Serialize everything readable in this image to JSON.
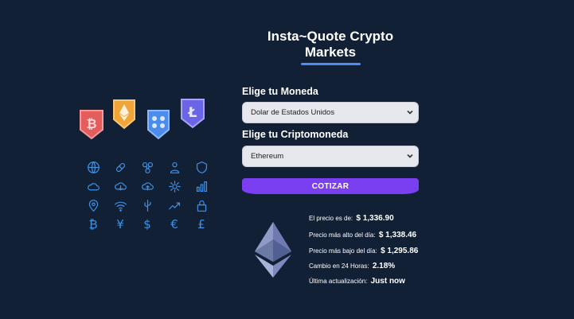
{
  "header": {
    "title": "Insta~Quote Crypto Markets"
  },
  "form": {
    "currency_label": "Elige tu Moneda",
    "currency_value": "Dolar de Estados Unidos",
    "crypto_label": "Elige tu Criptomoneda",
    "crypto_value": "Ethereum",
    "submit_label": "COTIZAR"
  },
  "result": {
    "price_label": "El precio es de:",
    "price_value": "$ 1,336.90",
    "high_label": "Precio más alto del día:",
    "high_value": "$ 1,338.46",
    "low_label": "Precio más bajo del día:",
    "low_value": "$ 1,295.86",
    "change_label": "Cambio en 24 Horas:",
    "change_value": "2.18%",
    "updated_label": "Última actualización:",
    "updated_value": "Just now"
  },
  "illustration": {
    "coins": [
      "bitcoin",
      "ethereum",
      "ripple",
      "litecoin"
    ],
    "currency_symbols": [
      "₿",
      "¥",
      "$",
      "€",
      "£"
    ]
  },
  "colors": {
    "background": "#122036",
    "accent": "#7b3ff2",
    "underline": "#4f8cf6",
    "icon": "#3f92e8"
  }
}
